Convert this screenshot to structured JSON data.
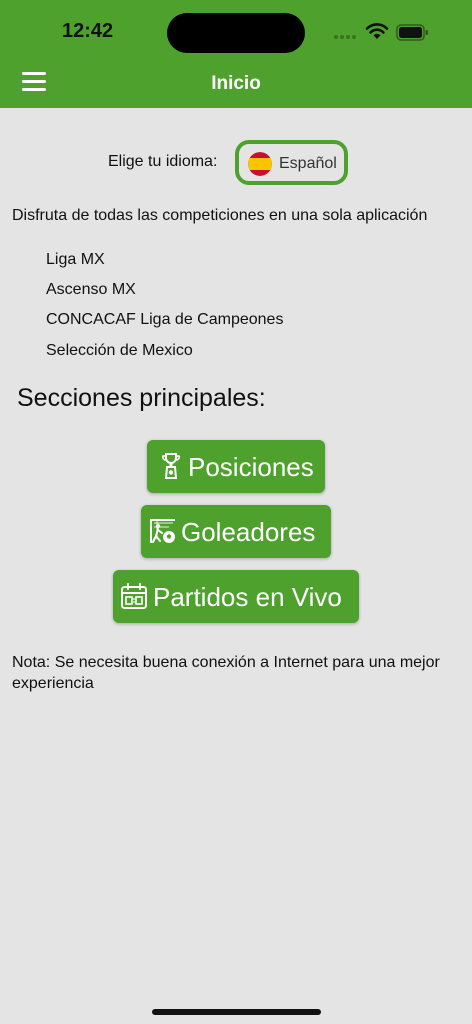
{
  "status": {
    "time": "12:42"
  },
  "header": {
    "title": "Inicio"
  },
  "language": {
    "label": "Elige tu idioma:",
    "selected": "Español"
  },
  "intro": "Disfruta de todas las competiciones en una sola aplicación",
  "competitions": [
    "Liga MX",
    "Ascenso MX",
    "CONCACAF Liga de Campeones",
    "Selección de Mexico"
  ],
  "sections": {
    "title": "Secciones principales:",
    "buttons": [
      {
        "label": "Posiciones",
        "icon": "trophy-icon"
      },
      {
        "label": "Goleadores",
        "icon": "goal-icon"
      },
      {
        "label": "Partidos en Vivo",
        "icon": "calendar-scoreboard-icon"
      }
    ]
  },
  "note": "Nota: Se necesita buena conexión a Internet para una mejor experiencia",
  "colors": {
    "accent": "#4ea12c",
    "background": "#e4e4e4"
  }
}
